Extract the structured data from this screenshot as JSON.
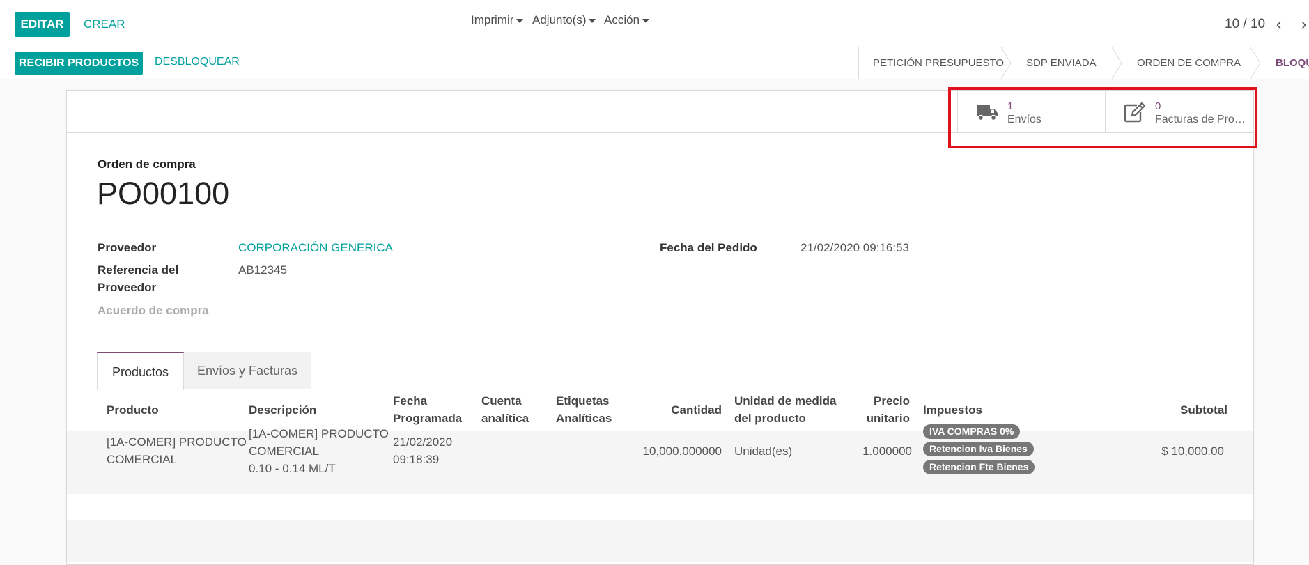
{
  "control_panel": {
    "edit_label": "EDITAR",
    "create_label": "CREAR",
    "print_label": "Imprimir",
    "attach_label": "Adjunto(s)",
    "action_label": "Acción",
    "pager_value": "10 / 10",
    "pager_prev": "‹",
    "pager_next": "›"
  },
  "statusbar": {
    "receive_label": "RECIBIR PRODUCTOS",
    "unlock_label": "DESBLOQUEAR",
    "stages": [
      "PETICIÓN PRESUPUESTO",
      "SDP ENVIADA",
      "ORDEN DE COMPRA",
      "BLOQUEADO"
    ],
    "active_stage": "BLOQUEADO"
  },
  "smart_buttons": {
    "shipments": {
      "count": "1",
      "label": "Envíos",
      "icon": "truck-icon"
    },
    "bills": {
      "count": "0",
      "label": "Facturas de Prov...",
      "icon": "edit-icon"
    }
  },
  "document": {
    "type_label": "Orden de compra",
    "name": "PO00100",
    "vendor_label": "Proveedor",
    "vendor_value": "CORPORACIÓN GENERICA",
    "vendor_ref_label_1": "Referencia del",
    "vendor_ref_label_2": "Proveedor",
    "vendor_ref_value": "AB12345",
    "agreement_label": "Acuerdo de compra",
    "order_date_label": "Fecha del Pedido",
    "order_date_value": "21/02/2020 09:16:53"
  },
  "tabs": [
    {
      "label": "Productos",
      "active": true
    },
    {
      "label": "Envíos y Facturas",
      "active": false
    }
  ],
  "table": {
    "headers": {
      "product": "Producto",
      "description": "Descripción",
      "date_1": "Fecha",
      "date_2": "Programada",
      "account_1": "Cuenta",
      "account_2": "analítica",
      "tags_1": "Etiquetas",
      "tags_2": "Analíticas",
      "qty": "Cantidad",
      "uom_1": "Unidad de medida",
      "uom_2": "del producto",
      "price_1": "Precio",
      "price_2": "unitario",
      "taxes": "Impuestos",
      "subtotal": "Subtotal"
    },
    "rows": [
      {
        "product_1": "[1A-COMER] PRODUCTO",
        "product_2": "COMERCIAL",
        "desc_1": "[1A-COMER] PRODUCTO",
        "desc_2": "COMERCIAL",
        "desc_3": "0.10 - 0.14 ML/T",
        "date_1": "21/02/2020",
        "date_2": "09:18:39",
        "qty": "10,000.000000",
        "uom": "Unidad(es)",
        "price": "1.000000",
        "taxes": [
          "IVA COMPRAS 0%",
          "Retencion Iva Bienes",
          "Retencion Fte Bienes"
        ],
        "subtotal": "$ 10,000.00"
      }
    ]
  },
  "colors": {
    "primary": "#00a09d",
    "accent": "#7c4b78",
    "highlight": "#e0111c"
  }
}
